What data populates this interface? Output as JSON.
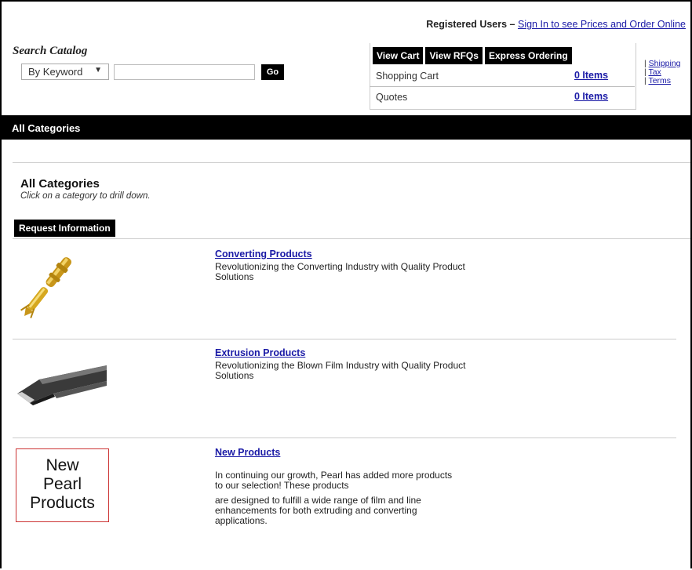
{
  "header": {
    "registered_prefix": "Registered Users – ",
    "sign_in_link": "Sign In to see Prices and Order Online"
  },
  "search": {
    "title": "Search Catalog",
    "mode_selected": "By Keyword",
    "mode_arrow": "▼",
    "query_value": "",
    "go_label": "Go"
  },
  "cart": {
    "tabs": [
      "View Cart",
      "View RFQs",
      "Express Ordering"
    ],
    "rows": [
      {
        "label": "Shopping Cart",
        "value": "0 Items"
      },
      {
        "label": "Quotes",
        "value": "0 Items"
      }
    ],
    "side_links": [
      "Shipping",
      "Tax",
      "Terms"
    ],
    "side_sep": "| "
  },
  "category_bar": {
    "title": "All Categories"
  },
  "section": {
    "heading": "All Categories",
    "hint": "Click on a category to drill down.",
    "request_button": "Request Information"
  },
  "products": [
    {
      "title": "Converting Products",
      "desc": "Revolutionizing the Converting Industry with Quality Product Solutions"
    },
    {
      "title": "Extrusion Products",
      "desc": "Revolutionizing the Blown Film Industry with Quality Product Solutions"
    },
    {
      "title": "New Products",
      "desc1": "In continuing our growth, Pearl has added more products to our selection!  These products",
      "desc2": "are designed to fulfill a wide range of film and line enhancements for both extruding and converting applications."
    }
  ],
  "new_pearl_image": {
    "lines": [
      "New",
      "Pearl",
      "Products"
    ]
  },
  "colors": {
    "link": "#1a1aa6",
    "bar": "#000000",
    "new_pearl_border": "#cc3333",
    "brass": "#d8a821"
  }
}
